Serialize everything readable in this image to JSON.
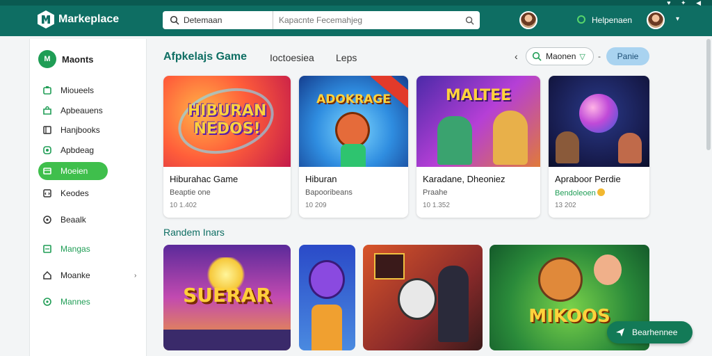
{
  "header": {
    "brand": "Markeplace",
    "search_category": "Detemaan",
    "search_placeholder": "Kapacnte Fecemahjeg",
    "username": "Helpenaen",
    "system_icons": "♥ ✦ ◀"
  },
  "sidebar": {
    "head_label": "Maonts",
    "head_icon_text": "M",
    "items": [
      {
        "label": "Mioueels",
        "icon": "cart-icon"
      },
      {
        "label": "Apbeauens",
        "icon": "bag-icon"
      },
      {
        "label": "Hanjbooks",
        "icon": "book-icon"
      },
      {
        "label": "Apbdeag",
        "icon": "app-icon"
      },
      {
        "label": "Moeien",
        "icon": "movie-icon",
        "active": true
      },
      {
        "label": "Keodes",
        "icon": "code-icon"
      },
      {
        "label": "Beaalk",
        "icon": "circle-icon"
      },
      {
        "label": "Mangas",
        "icon": "book-icon"
      },
      {
        "label": "Moanke",
        "icon": "home-icon"
      },
      {
        "label": "Mannes",
        "icon": "circle-icon"
      }
    ]
  },
  "main": {
    "title": "Afpkelajs Game",
    "tabs": [
      "Ioctoesiea",
      "Leps"
    ],
    "filter_label": "Maonen",
    "dash": "-",
    "cta_label": "Panie",
    "cards": [
      {
        "title": "Hiburahac Game",
        "subtitle": "Beaptie one",
        "meta": "10 1.402",
        "art_text": "HIBURAN NEDOS!"
      },
      {
        "title": "Hiburan",
        "subtitle": "Bapooribeans",
        "meta": "10 209",
        "art_text": "ADOKRAGE"
      },
      {
        "title": "Karadane, Dheoniez",
        "subtitle": "Praahe",
        "meta": "10 1.352",
        "art_text": "MALTEE"
      },
      {
        "title": "Apraboor Perdie",
        "subtitle": "Bendoleoen",
        "meta": "13 202",
        "art_text": ""
      }
    ],
    "section2_title": "Randem Inars",
    "tiles": [
      {
        "art_text": "SUERAR"
      },
      {
        "art_text": ""
      },
      {
        "art_text": ""
      },
      {
        "art_text": "MIKOOS"
      }
    ]
  },
  "fab_label": "Bearhennee",
  "colors": {
    "brand": "#0e6e63",
    "accent": "#3fbf4c",
    "cta": "#a9d3f0"
  }
}
